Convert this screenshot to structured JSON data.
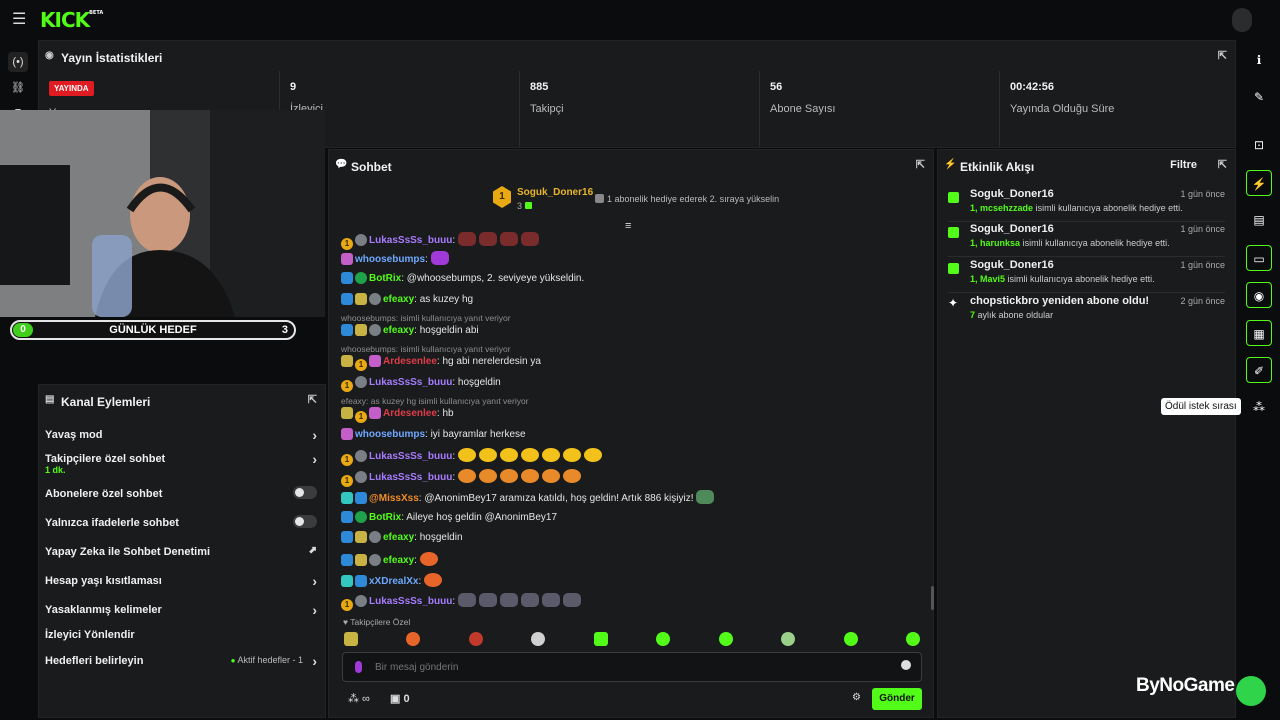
{
  "brand": {
    "logo": "KICK",
    "badge": "BETA"
  },
  "stats": {
    "title": "Yayın İstatistikleri",
    "live_badge": "YAYINDA",
    "live_caption": "Yayın",
    "items": [
      {
        "value": "9",
        "label": "İzleyici"
      },
      {
        "value": "885",
        "label": "Takipçi"
      },
      {
        "value": "56",
        "label": "Abone Sayısı"
      },
      {
        "value": "00:42:56",
        "label": "Yayında Olduğu Süre"
      }
    ]
  },
  "goal": {
    "start": "0",
    "label": "GÜNLÜK HEDEF",
    "end": "3"
  },
  "channel_actions": {
    "title": "Kanal Eylemleri",
    "rows": [
      {
        "label": "Yavaş mod"
      },
      {
        "label": "Takipçilere özel sohbet",
        "sub": "1 dk."
      },
      {
        "label": "Abonelere özel sohbet"
      },
      {
        "label": "Yalnızca ifadelerle sohbet"
      },
      {
        "label": "Yapay Zeka ile Sohbet Denetimi"
      },
      {
        "label": "Hesap yaşı kısıtlaması"
      },
      {
        "label": "Yasaklanmış kelimeler"
      },
      {
        "label": "İzleyici Yönlendir"
      },
      {
        "label": "Hedefleri belirleyin",
        "aside": "Aktif hedefler - 1"
      }
    ]
  },
  "chat": {
    "title": "Sohbet",
    "pinned": {
      "rank": "1",
      "user": "Soguk_Doner16",
      "count": "3",
      "text": "1 abonelik hediye ederek 2. sıraya yükselin"
    },
    "messages": [
      {
        "user": "LukasSsSs_buuu",
        "text": ":"
      },
      {
        "user": "whoosebumps",
        "text": ":"
      },
      {
        "user": "BotRix",
        "text": ": @whoosebumps, 2. seviyeye yükseldin."
      },
      {
        "user": "efeaxy",
        "text": ": as kuzey hg"
      },
      {
        "reply": "whoosebumps:  isimli kullanıcıya yanıt veriyor",
        "user": "efeaxy",
        "text": ": hoşgeldin abi"
      },
      {
        "reply": "whoosebumps:  isimli kullanıcıya yanıt veriyor",
        "user": "Ardesenlee",
        "text": ": hg abi nerelerdesin ya"
      },
      {
        "user": "LukasSsSs_buuu",
        "text": ": hoşgeldin"
      },
      {
        "reply": "efeaxy: as kuzey hg isimli kullanıcıya yanıt veriyor",
        "user": "Ardesenlee",
        "text": ": hb"
      },
      {
        "user": "whoosebumps",
        "text": ": iyi bayramlar herkese"
      },
      {
        "user": "LukasSsSs_buuu",
        "text": ":"
      },
      {
        "user": "LukasSsSs_buuu",
        "text": ":"
      },
      {
        "user": "@MissXss",
        "text": ": @AnonimBey17 aramıza katıldı, hoş geldin! Artık 886 kişiyiz!"
      },
      {
        "user": "BotRix",
        "text": ": Aileye hoş geldin @AnonimBey17"
      },
      {
        "user": "efeaxy",
        "text": ": hoşgeldin"
      },
      {
        "user": "efeaxy",
        "text": ":"
      },
      {
        "user": "xXDrealXx",
        "text": ":"
      },
      {
        "user": "LukasSsSs_buuu",
        "text": ":"
      }
    ],
    "emote_section": "Takipçilere Özel",
    "input_placeholder": "Bir mesaj gönderin",
    "footer_count": "0",
    "send_label": "Gönder"
  },
  "activity": {
    "title": "Etkinlik Akışı",
    "filter": "Filtre",
    "events": [
      {
        "name": "Soguk_Doner16",
        "num": "1,",
        "who": "mcsehzzade",
        "desc": "isimli kullanıcıya abonelik hediye etti.",
        "time": "1 gün önce"
      },
      {
        "name": "Soguk_Doner16",
        "num": "1,",
        "who": "harunksa",
        "desc": "isimli kullanıcıya abonelik hediye etti.",
        "time": "1 gün önce"
      },
      {
        "name": "Soguk_Doner16",
        "num": "1,",
        "who": "Mavi5",
        "desc": "isimli kullanıcıya abonelik hediye etti.",
        "time": "1 gün önce"
      },
      {
        "name": "chopstickbro yeniden abone oldu!",
        "num": "7",
        "who": "",
        "desc": "aylık abone oldular",
        "time": "2 gün önce"
      }
    ]
  },
  "tooltip": "Ödül istek sırası",
  "watermark": "ByNoGame",
  "colors": {
    "accent": "#53fc18",
    "live": "#e11b22",
    "panel": "#191b1c"
  }
}
